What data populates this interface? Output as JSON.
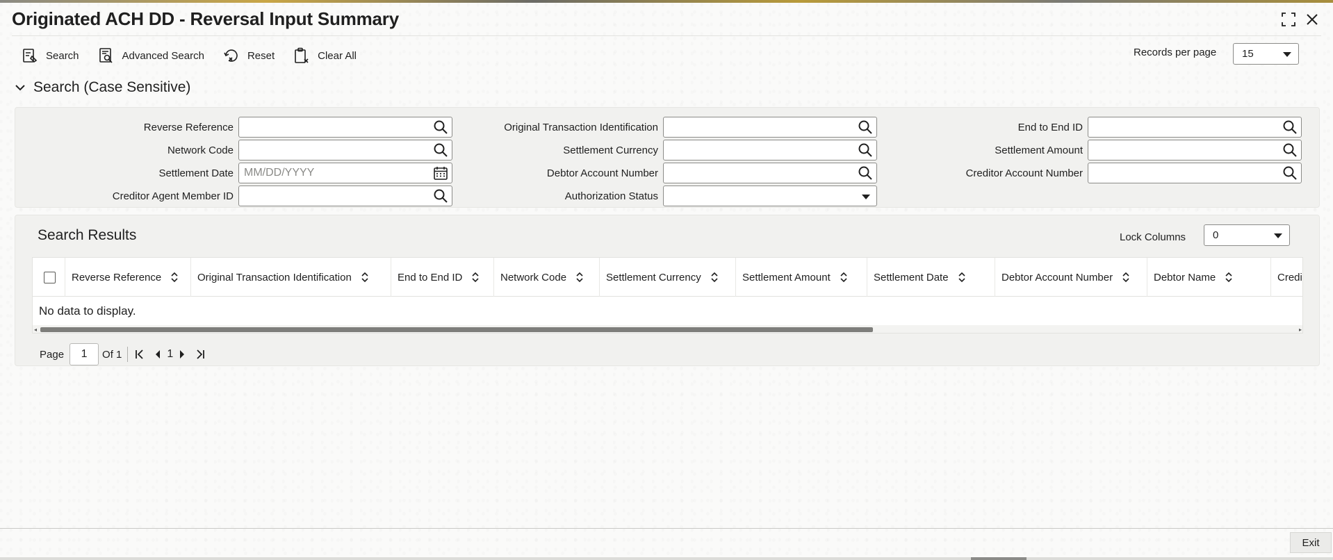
{
  "window": {
    "title": "Originated ACH DD - Reversal Input Summary",
    "maximize_icon": "maximize-icon",
    "close_icon": "close-icon"
  },
  "toolbar": {
    "search_label": "Search",
    "advanced_search_label": "Advanced Search",
    "reset_label": "Reset",
    "clear_all_label": "Clear All",
    "records_per_page_label": "Records per page",
    "records_per_page_value": "15"
  },
  "search_section": {
    "title": "Search (Case Sensitive)",
    "fields": {
      "reverse_reference": {
        "label": "Reverse Reference",
        "value": ""
      },
      "original_transaction_identification": {
        "label": "Original Transaction Identification",
        "value": ""
      },
      "end_to_end_id": {
        "label": "End to End ID",
        "value": ""
      },
      "network_code": {
        "label": "Network Code",
        "value": ""
      },
      "settlement_currency": {
        "label": "Settlement Currency",
        "value": ""
      },
      "settlement_amount": {
        "label": "Settlement Amount",
        "value": ""
      },
      "settlement_date": {
        "label": "Settlement Date",
        "value": "",
        "placeholder": "MM/DD/YYYY"
      },
      "debtor_account_number": {
        "label": "Debtor Account Number",
        "value": ""
      },
      "creditor_account_number": {
        "label": "Creditor Account Number",
        "value": ""
      },
      "creditor_agent_member_id": {
        "label": "Creditor Agent Member ID",
        "value": ""
      },
      "authorization_status": {
        "label": "Authorization Status",
        "value": ""
      }
    }
  },
  "results": {
    "title": "Search Results",
    "lock_columns_label": "Lock Columns",
    "lock_columns_value": "0",
    "columns": [
      "Reverse Reference",
      "Original Transaction Identification",
      "End to End ID",
      "Network Code",
      "Settlement Currency",
      "Settlement Amount",
      "Settlement Date",
      "Debtor Account Number",
      "Debtor Name",
      "Credi"
    ],
    "empty_message": "No data to display."
  },
  "pagination": {
    "page_label": "Page",
    "current_page": "1",
    "of_label": "Of 1",
    "page_link": "1"
  },
  "footer": {
    "exit_label": "Exit"
  }
}
